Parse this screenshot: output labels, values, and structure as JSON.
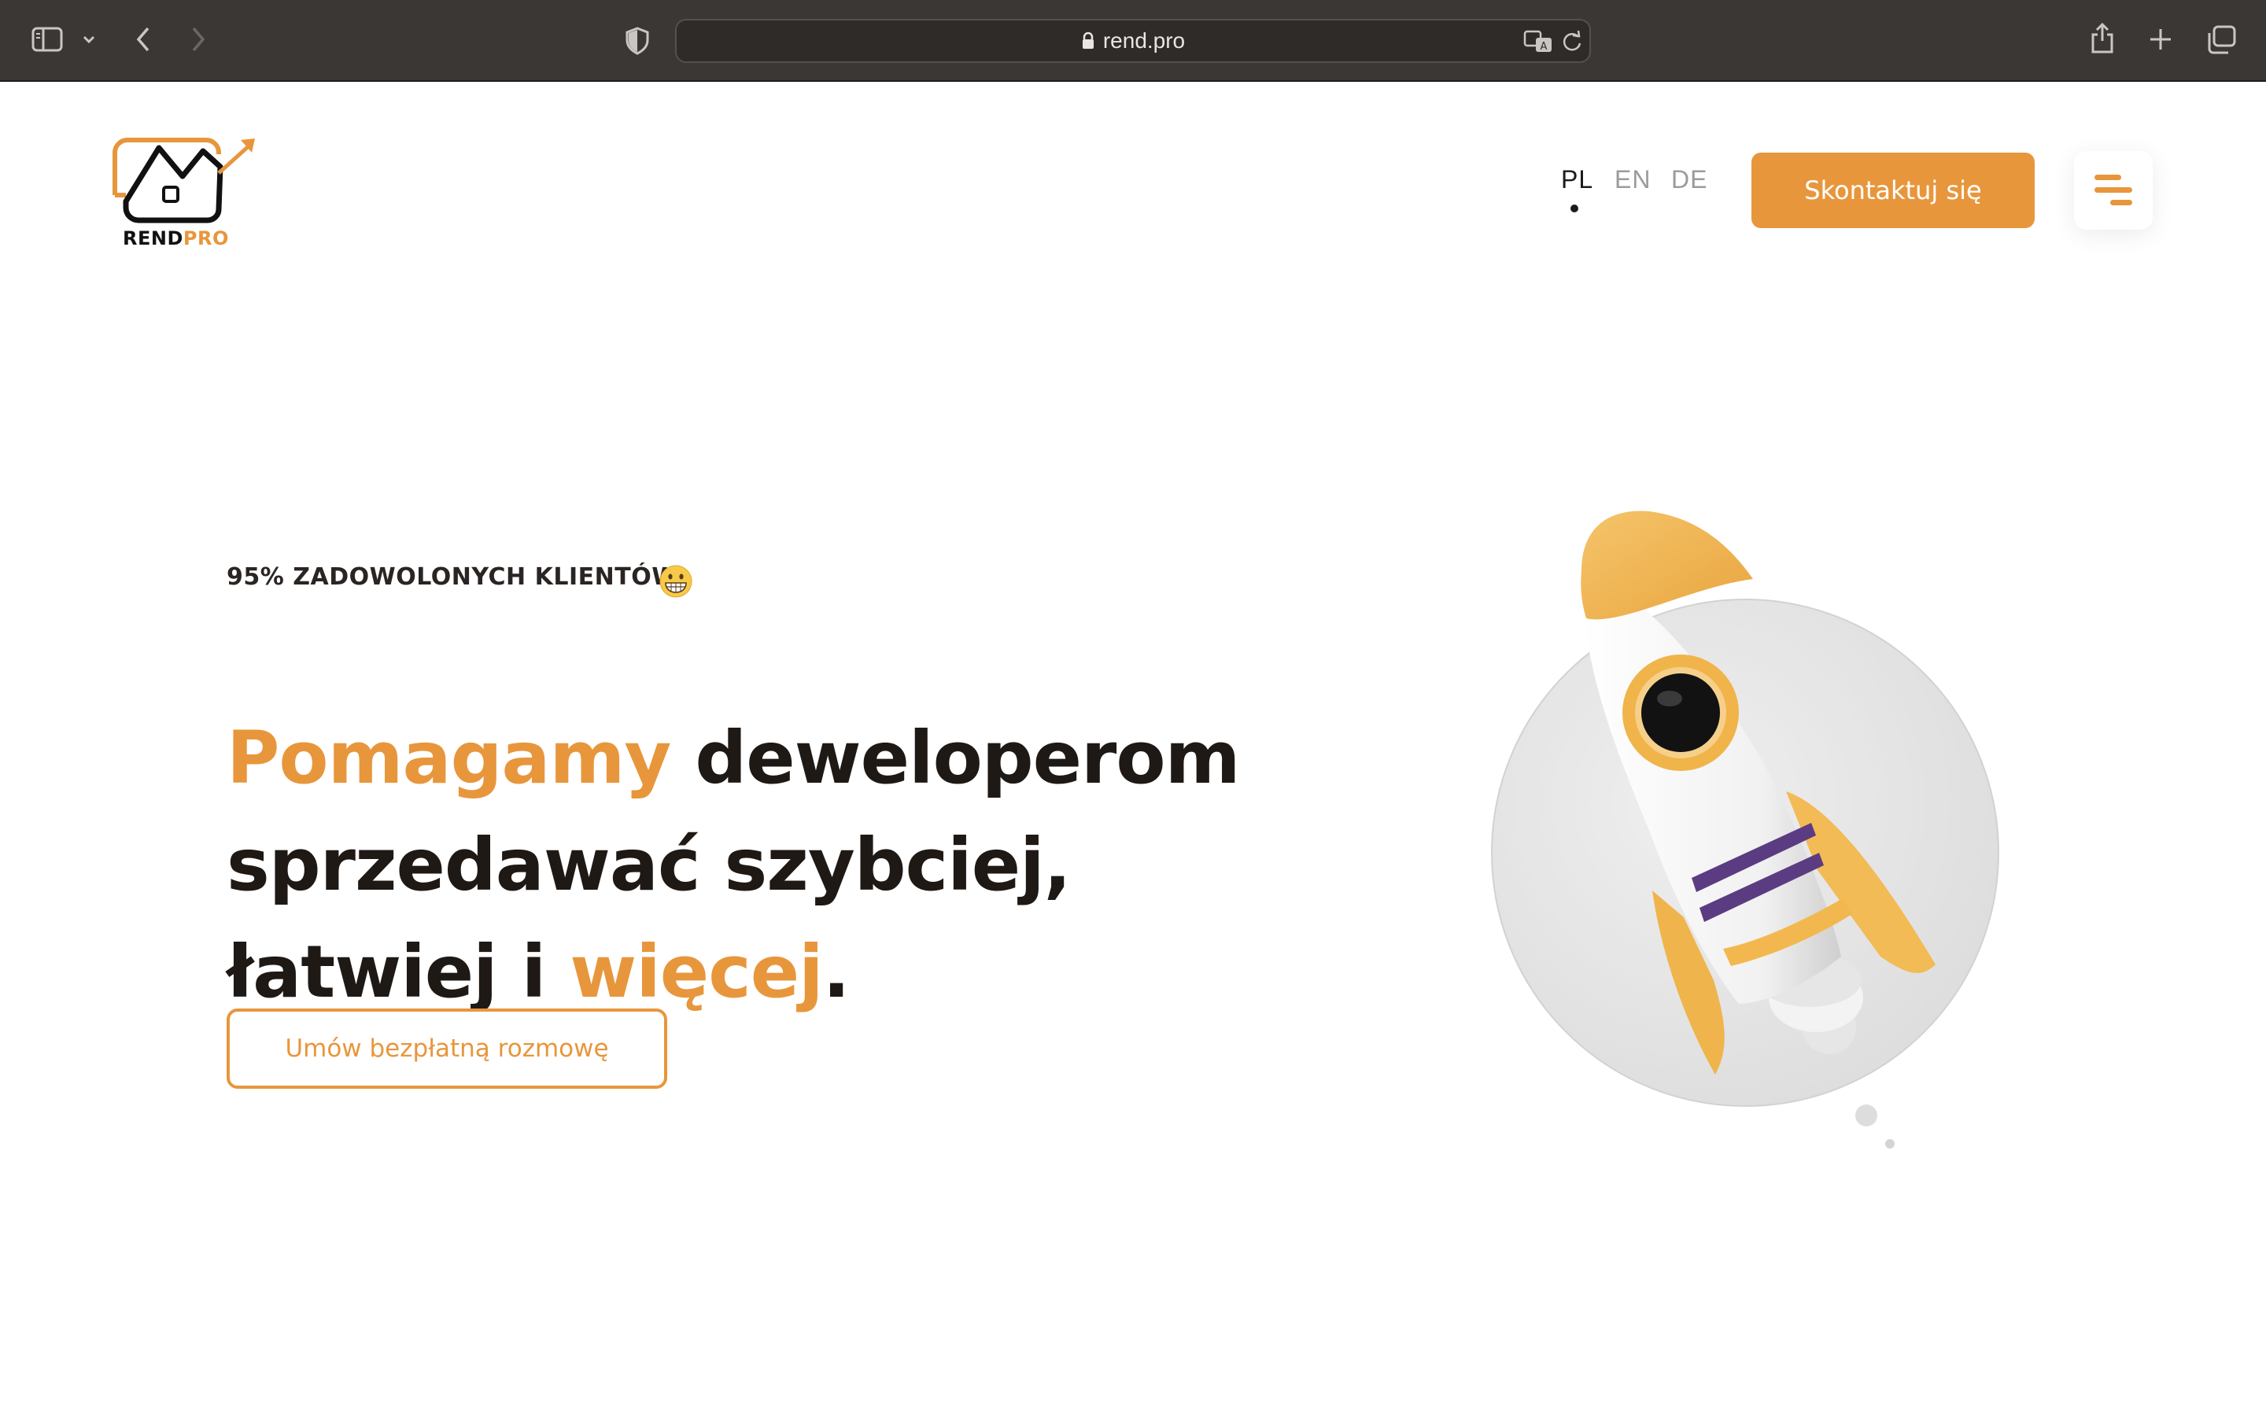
{
  "browser": {
    "url": "rend.pro",
    "icons": [
      "sidebar-icon",
      "chevron-down-icon",
      "back-icon",
      "forward-icon",
      "shield-icon",
      "lock-icon",
      "translate-icon",
      "reload-icon",
      "share-icon",
      "new-tab-icon",
      "tabs-overview-icon"
    ]
  },
  "header": {
    "logo": {
      "text_main": "REND",
      "text_accent": "PRO"
    },
    "languages": [
      {
        "code": "PL",
        "active": true
      },
      {
        "code": "EN",
        "active": false
      },
      {
        "code": "DE",
        "active": false
      }
    ],
    "contact_label": "Skontaktuj się",
    "menu_icon": "hamburger-menu-icon"
  },
  "hero": {
    "kicker": "95% ZADOWOLONYCH KLIENTÓW",
    "kicker_emoji": "grinning-face-icon",
    "headline": {
      "part1_accent": "Pomagamy",
      "part2": " deweloperom",
      "part3": "sprzedawać szybciej,",
      "part4": "łatwiej i ",
      "part5_accent": "więcej",
      "part6": "."
    },
    "cta_label": "Umów bezpłatną rozmowę",
    "illustration": "rocket-illustration"
  },
  "colors": {
    "accent": "#e8963c",
    "text_dark": "#1f1915",
    "chrome_bg": "#3b3735"
  }
}
